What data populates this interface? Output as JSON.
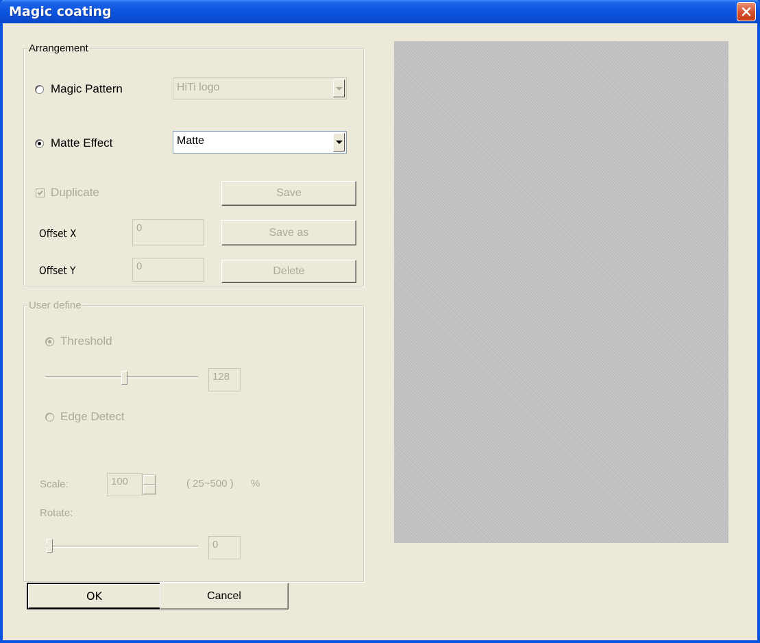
{
  "window": {
    "title": "Magic coating"
  },
  "arrangement": {
    "legend": "Arrangement",
    "magic_pattern": {
      "label": "Magic Pattern",
      "selected": false,
      "value": "HiTi logo"
    },
    "matte_effect": {
      "label": "Matte Effect",
      "selected": true,
      "value": "Matte"
    },
    "duplicate": {
      "label": "Duplicate",
      "checked": true
    },
    "offset_x": {
      "label": "Offset X",
      "value": "0"
    },
    "offset_y": {
      "label": "Offset Y",
      "value": "0"
    },
    "buttons": {
      "save": "Save",
      "save_as": "Save as",
      "delete": "Delete"
    }
  },
  "user_define": {
    "legend": "User define",
    "threshold": {
      "label": "Threshold",
      "selected": true,
      "value": "128",
      "level": 0.5
    },
    "edge_detect": {
      "label": "Edge Detect",
      "selected": false
    },
    "scale": {
      "label": "Scale:",
      "value": "100",
      "range": "( 25~500 )",
      "unit": "%"
    },
    "rotate": {
      "label": "Rotate:",
      "value": "0",
      "level": 0.0
    }
  },
  "footer": {
    "ok": "OK",
    "cancel": "Cancel"
  }
}
